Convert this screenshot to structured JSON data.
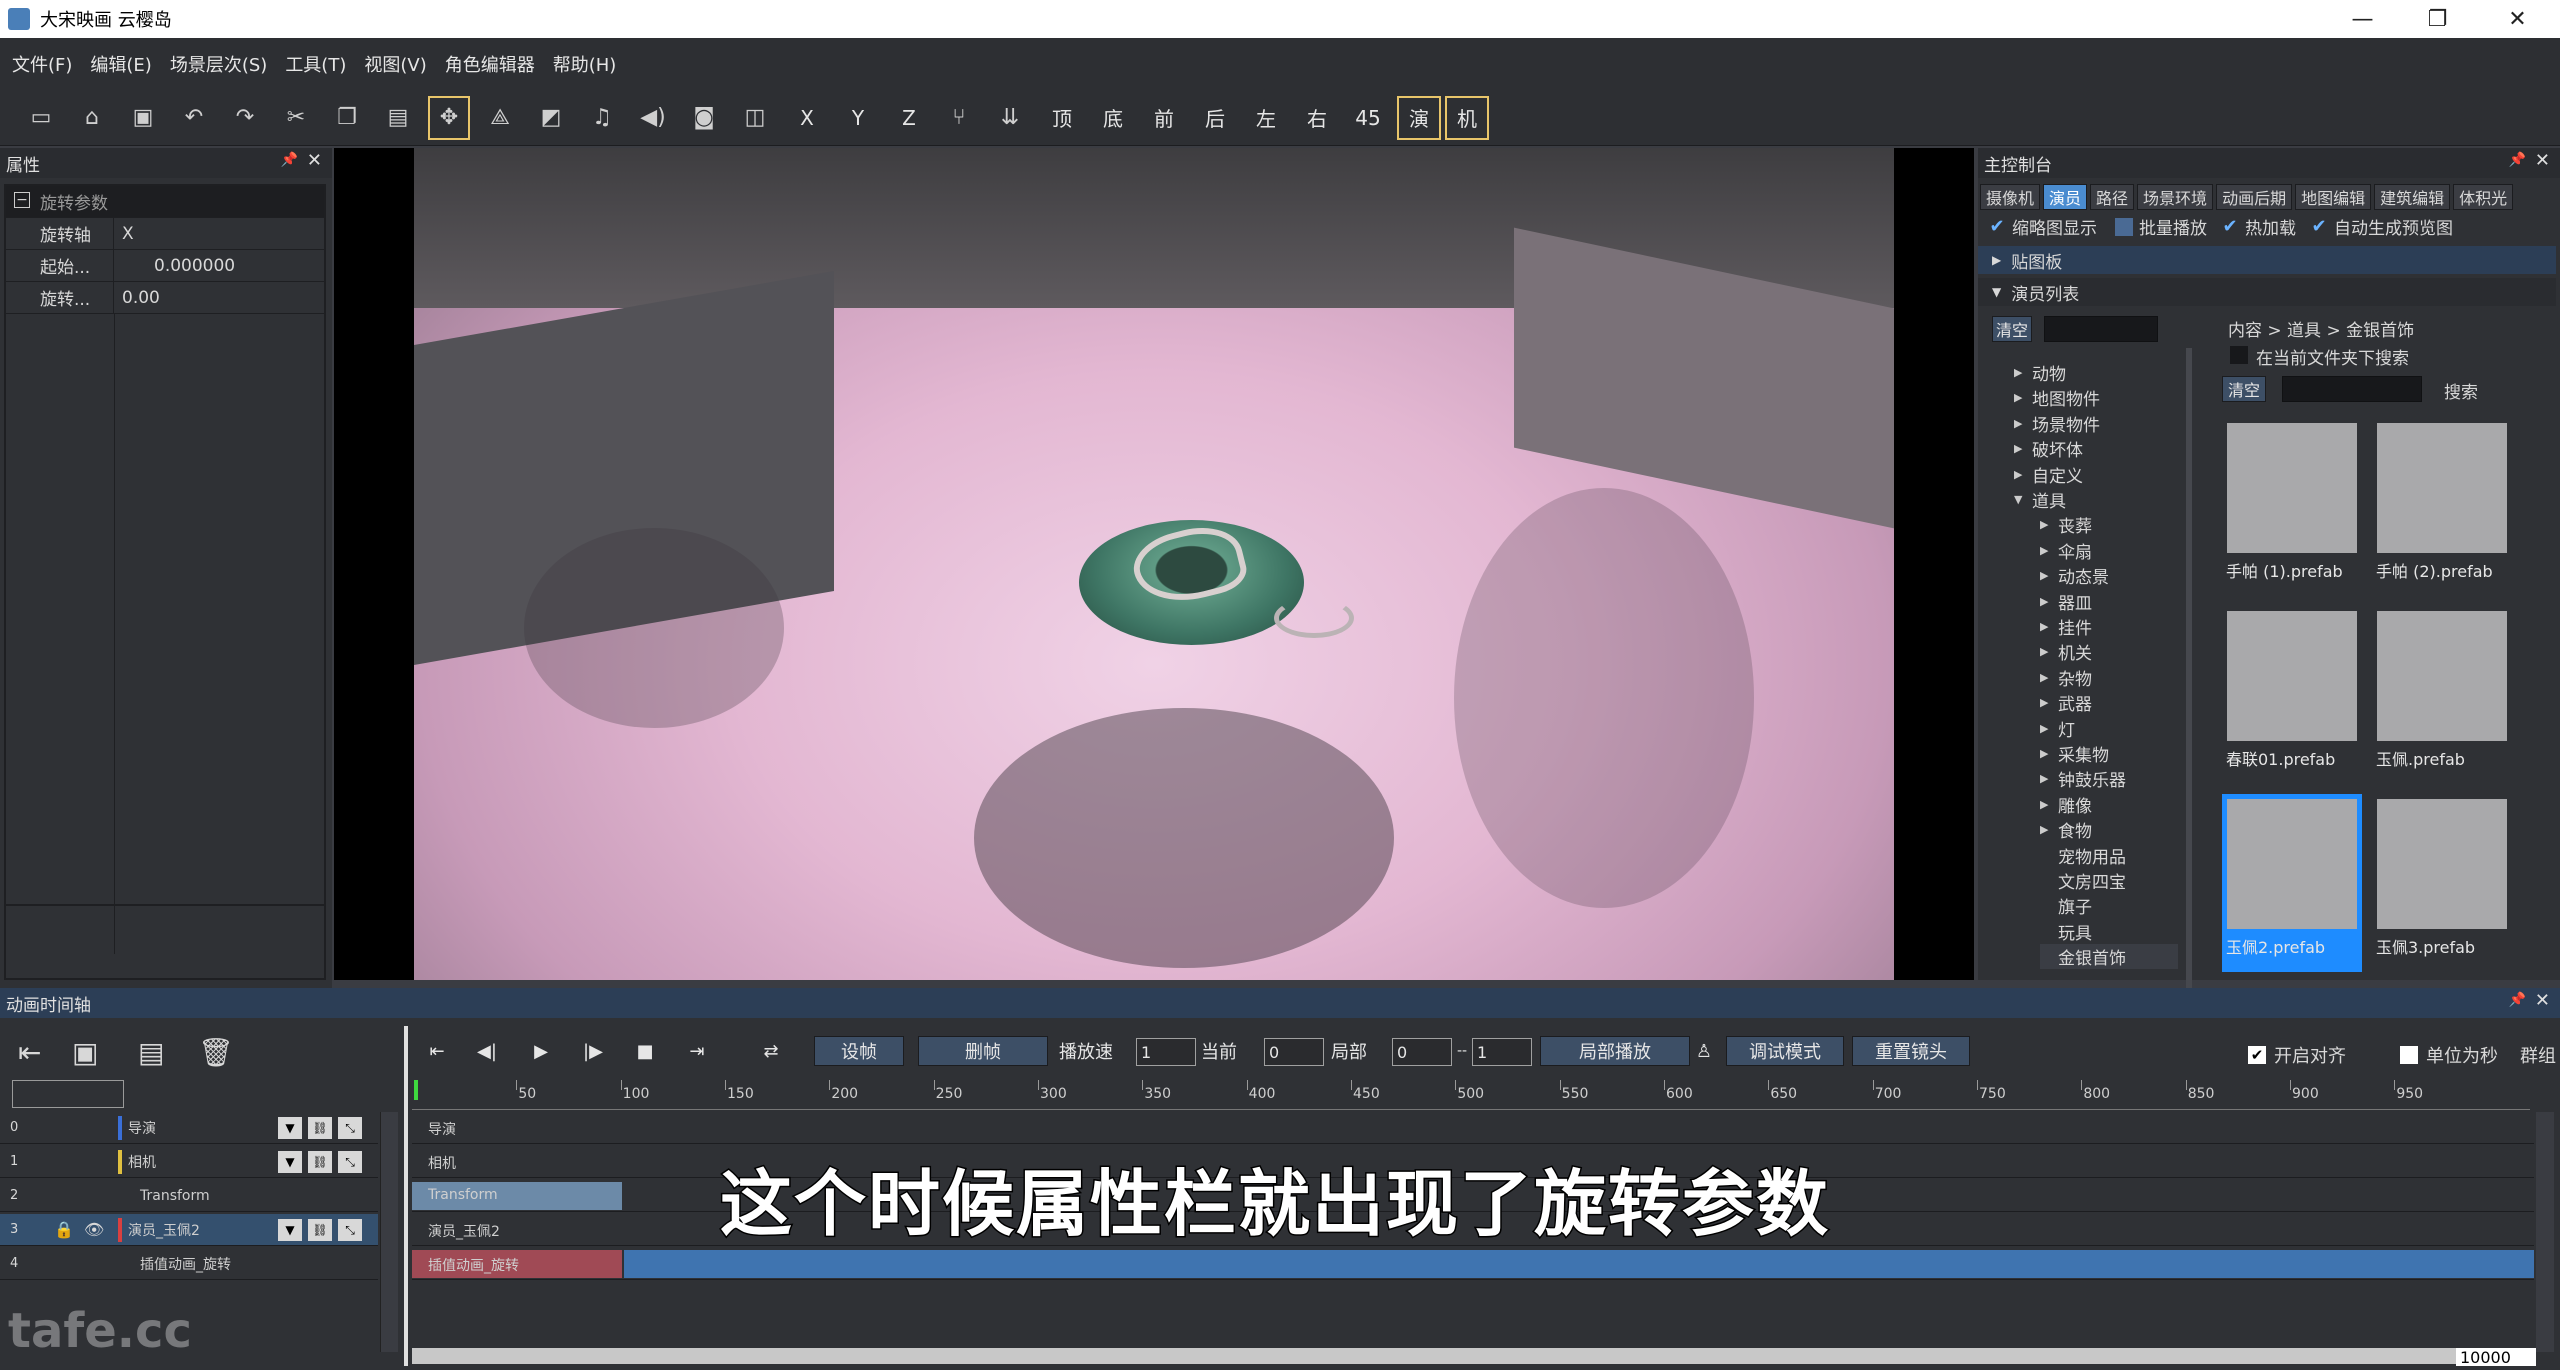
{
  "window": {
    "title": "大宋映画 云樱岛",
    "minimize": "—",
    "maximize": "❐",
    "close": "✕"
  },
  "menu": [
    "文件(F)",
    "编辑(E)",
    "场景层次(S)",
    "工具(T)",
    "视图(V)",
    "角色编辑器",
    "帮助(H)"
  ],
  "toolbar": {
    "axis_labels": [
      "X",
      "Y",
      "Z"
    ],
    "view_labels": [
      "顶",
      "底",
      "前",
      "后",
      "左",
      "右",
      "45"
    ],
    "mode_labels": [
      "演",
      "机"
    ]
  },
  "properties": {
    "title": "属性",
    "group": "旋转参数",
    "rows": [
      {
        "key": "旋转轴",
        "value": "X"
      },
      {
        "key": "起始...",
        "value": "0.000000"
      },
      {
        "key": "旋转...",
        "value": "0.00"
      }
    ]
  },
  "control": {
    "title": "主控制台",
    "tabs": [
      "摄像机",
      "演员",
      "路径",
      "场景环境",
      "动画后期",
      "地图编辑",
      "建筑编辑",
      "体积光"
    ],
    "active_tab": "演员",
    "options": [
      {
        "label": "缩略图显示",
        "checked": true
      },
      {
        "label": "批量播放",
        "checked": false
      },
      {
        "label": "热加载",
        "checked": true
      },
      {
        "label": "自动生成预览图",
        "checked": true
      }
    ],
    "sections": {
      "clipboard": "贴图板",
      "actors": "演员列表"
    },
    "clear_label": "清空",
    "breadcrumb": "内容 > 道具 > 金银首饰",
    "search_in_folder": "在当前文件夹下搜索",
    "search_label": "搜索",
    "tree": [
      {
        "label": "动物",
        "indent": 0,
        "arrow": "▶"
      },
      {
        "label": "地图物件",
        "indent": 0,
        "arrow": "▶"
      },
      {
        "label": "场景物件",
        "indent": 0,
        "arrow": "▶"
      },
      {
        "label": "破坏体",
        "indent": 0,
        "arrow": "▶"
      },
      {
        "label": "自定义",
        "indent": 0,
        "arrow": "▶"
      },
      {
        "label": "道具",
        "indent": 0,
        "arrow": "▼"
      },
      {
        "label": "丧葬",
        "indent": 1,
        "arrow": "▶"
      },
      {
        "label": "伞扇",
        "indent": 1,
        "arrow": "▶"
      },
      {
        "label": "动态景",
        "indent": 1,
        "arrow": "▶"
      },
      {
        "label": "器皿",
        "indent": 1,
        "arrow": "▶"
      },
      {
        "label": "挂件",
        "indent": 1,
        "arrow": "▶"
      },
      {
        "label": "机关",
        "indent": 1,
        "arrow": "▶"
      },
      {
        "label": "杂物",
        "indent": 1,
        "arrow": "▶"
      },
      {
        "label": "武器",
        "indent": 1,
        "arrow": "▶"
      },
      {
        "label": "灯",
        "indent": 1,
        "arrow": "▶"
      },
      {
        "label": "采集物",
        "indent": 1,
        "arrow": "▶"
      },
      {
        "label": "钟鼓乐器",
        "indent": 1,
        "arrow": "▶"
      },
      {
        "label": "雕像",
        "indent": 1,
        "arrow": "▶"
      },
      {
        "label": "食物",
        "indent": 1,
        "arrow": "▶"
      },
      {
        "label": "宠物用品",
        "indent": 1,
        "arrow": ""
      },
      {
        "label": "文房四宝",
        "indent": 1,
        "arrow": ""
      },
      {
        "label": "旗子",
        "indent": 1,
        "arrow": ""
      },
      {
        "label": "玩具",
        "indent": 1,
        "arrow": ""
      },
      {
        "label": "金银首饰",
        "indent": 1,
        "arrow": ""
      }
    ],
    "assets": [
      {
        "name": "手帕 (1).prefab",
        "color": "#a9a9ab",
        "selected": false
      },
      {
        "name": "手帕 (2).prefab",
        "color": "#a9a9ab",
        "selected": false
      },
      {
        "name": "春联01.prefab",
        "color": "#a9a9ab",
        "selected": false
      },
      {
        "name": "玉佩.prefab",
        "color": "#a9a9ab",
        "selected": false
      },
      {
        "name": "玉佩2.prefab",
        "color": "#a9a9ab",
        "selected": true
      },
      {
        "name": "玉佩3.prefab",
        "color": "#a9a9ab",
        "selected": false
      }
    ]
  },
  "timeline": {
    "title": "动画时间轴",
    "controls": {
      "set_frame": "设帧",
      "delete_frame": "删帧",
      "speed_label": "播放速",
      "speed_value": "1",
      "current_label": "当前",
      "current_value": "0",
      "local_label": "局部",
      "local_from": "0",
      "local_sep": "--",
      "local_to": "1",
      "local_play": "局部播放",
      "debug_mode": "调试模式",
      "reset_camera": "重置镜头",
      "align_label": "开启对齐",
      "align_checked": true,
      "unit_label": "单位为秒",
      "unit_checked": false,
      "group_label": "群组"
    },
    "ruler": [
      50,
      100,
      150,
      200,
      250,
      300,
      350,
      400,
      450,
      500,
      550,
      600,
      650,
      700,
      750,
      800,
      850,
      900,
      950
    ],
    "rows": [
      {
        "index": "0",
        "name": "导演",
        "track_label": "导演",
        "marker": "#3a6fd8"
      },
      {
        "index": "1",
        "name": "相机",
        "track_label": "相机",
        "marker": "#e0c040"
      },
      {
        "index": "2",
        "name": "Transform",
        "track_label": "Transform",
        "marker": ""
      },
      {
        "index": "3",
        "name": "演员_玉佩2",
        "track_label": "演员_玉佩2",
        "marker": "#d84040"
      },
      {
        "index": "4",
        "name": "插值动画_旋转",
        "track_label": "插值动画_旋转",
        "marker": ""
      }
    ],
    "end_value": "10000"
  },
  "subtitle": "这个时候属性栏就出现了旋转参数",
  "watermark": "tafe.cc"
}
